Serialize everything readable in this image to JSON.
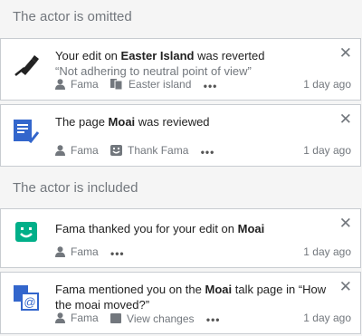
{
  "sections": [
    {
      "title": "The actor is omitted"
    },
    {
      "title": "The actor is included"
    }
  ],
  "notifications": [
    {
      "icon": "pencil-revert-icon",
      "pre": "Your edit on ",
      "bold": "Easter Island",
      "post": " was reverted",
      "quote": "“Not adhering to neutral point of view”",
      "actor": "Fama",
      "secondary": "Easter island",
      "secondary_icon": "pages-icon",
      "more": "•••",
      "time": "1 day ago"
    },
    {
      "icon": "page-reviewed-icon",
      "pre": "The page ",
      "bold": "Moai",
      "post": " was reviewed",
      "actor": "Fama",
      "secondary": "Thank Fama",
      "secondary_icon": "smiley-icon",
      "more": "•••",
      "time": "1 day ago"
    },
    {
      "icon": "thanks-smiley-icon",
      "pre": "Fama thanked you for your edit on ",
      "bold": "Moai",
      "post": "",
      "actor": "Fama",
      "more": "•••",
      "time": "1 day ago"
    },
    {
      "icon": "mention-icon",
      "pre": "Fama mentioned you on the ",
      "bold": "Moai",
      "post": " talk page in “How the moai moved?”",
      "actor": "Fama",
      "secondary": "View changes",
      "secondary_icon": "changes-icon",
      "more": "•••",
      "time": "1 day ago"
    }
  ],
  "close_glyph": "✕",
  "colors": {
    "accent_blue": "#3366cc",
    "green": "#00af89",
    "muted": "#72777d",
    "border": "#c8ccd1"
  }
}
